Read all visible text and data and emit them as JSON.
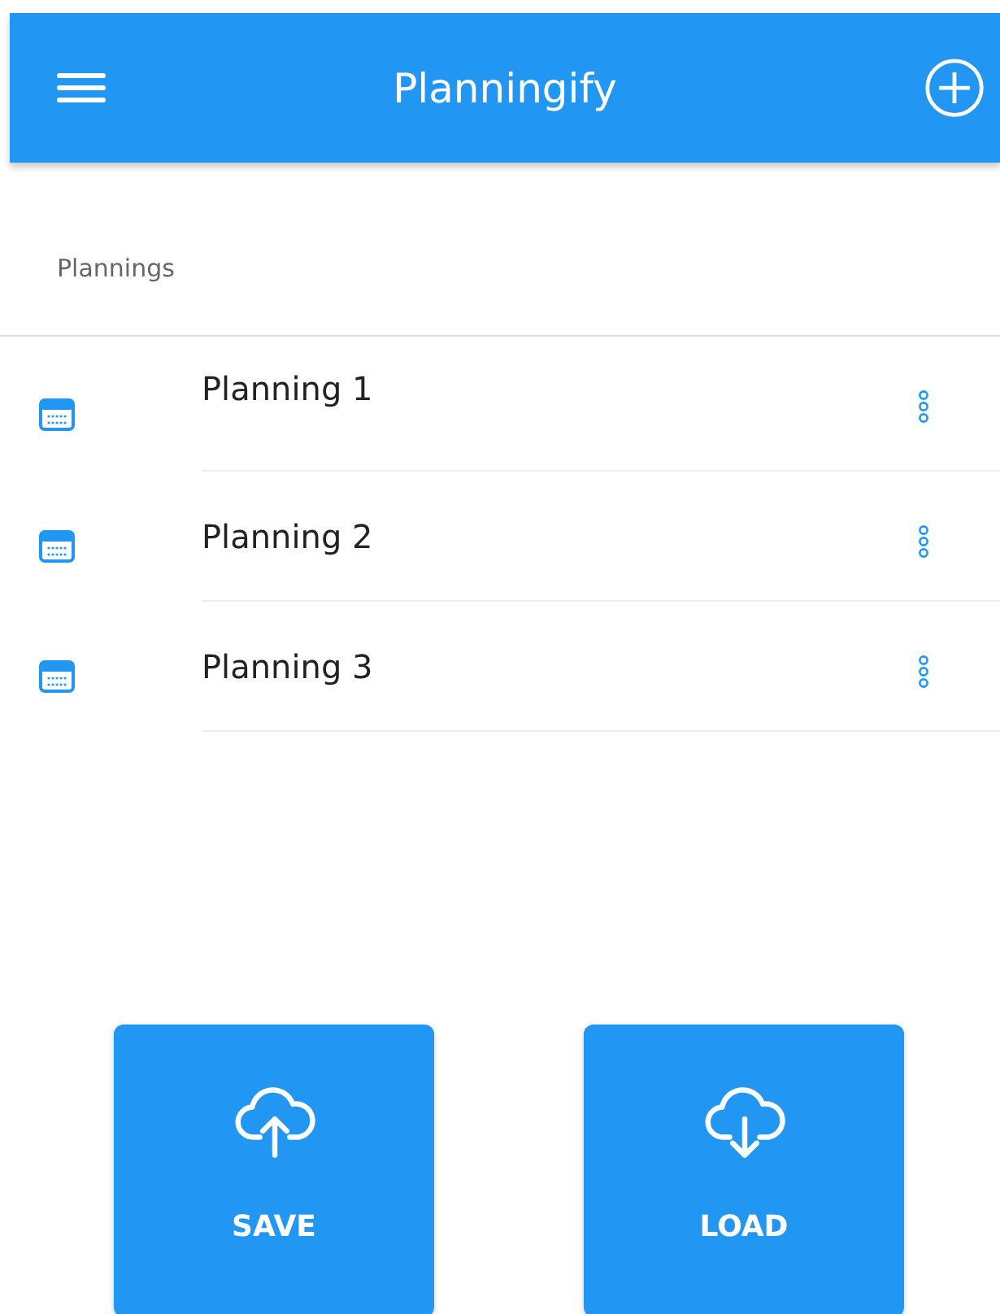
{
  "app_bar": {
    "title": "Planningify"
  },
  "section": {
    "title": "Plannings"
  },
  "plannings": [
    {
      "name": "Planning 1"
    },
    {
      "name": "Planning 2"
    },
    {
      "name": "Planning 3"
    }
  ],
  "actions": [
    {
      "label": "SAVE",
      "kind": "upload"
    },
    {
      "label": "LOAD",
      "kind": "download"
    }
  ]
}
